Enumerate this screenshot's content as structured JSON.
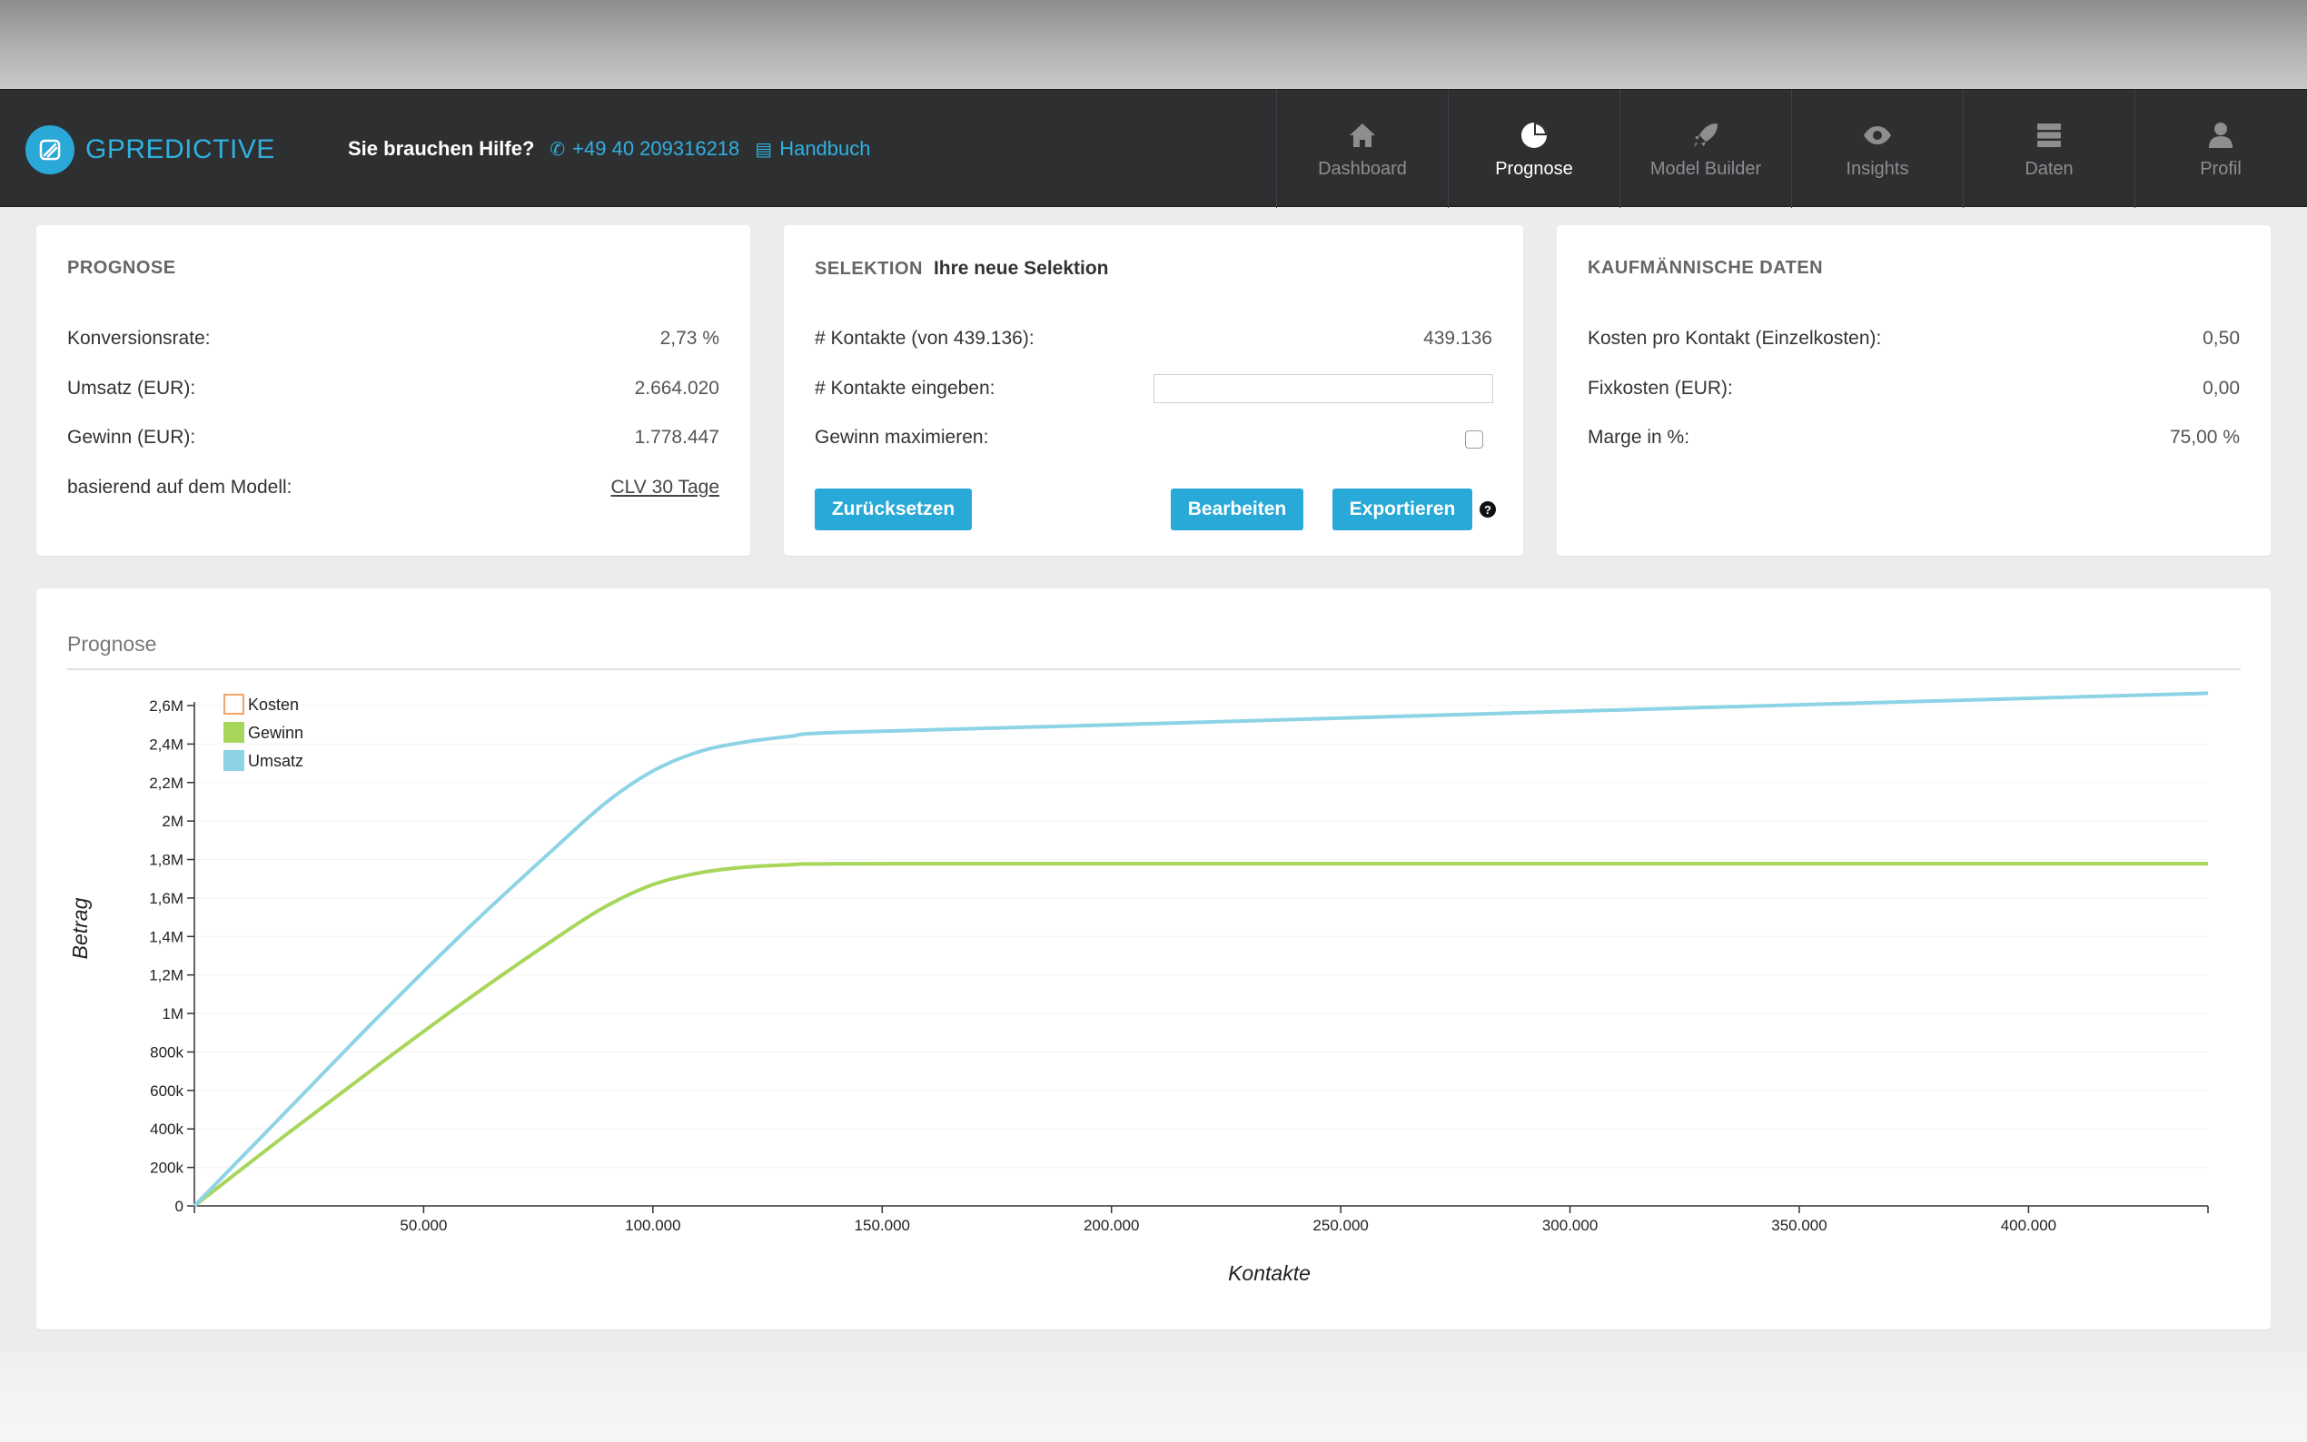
{
  "brand": {
    "name": "GPREDICTIVE"
  },
  "help": {
    "label": "Sie brauchen Hilfe?",
    "phone": "+49 40 209316218",
    "manual": "Handbuch"
  },
  "nav": {
    "items": [
      {
        "label": "Dashboard",
        "icon": "home-icon"
      },
      {
        "label": "Prognose",
        "icon": "pie-chart-icon",
        "active": true
      },
      {
        "label": "Model Builder",
        "icon": "rocket-icon"
      },
      {
        "label": "Insights",
        "icon": "eye-icon"
      },
      {
        "label": "Daten",
        "icon": "database-icon"
      },
      {
        "label": "Profil",
        "icon": "user-icon"
      }
    ]
  },
  "prognose": {
    "title": "PROGNOSE",
    "rows": [
      {
        "label": "Konversionsrate:",
        "value": "2,73 %"
      },
      {
        "label": "Umsatz (EUR):",
        "value": "2.664.020"
      },
      {
        "label": "Gewinn (EUR):",
        "value": "1.778.447"
      },
      {
        "label": "basierend auf dem Modell:",
        "value": "CLV 30 Tage"
      }
    ]
  },
  "selektion": {
    "title": "SELEKTION",
    "subtitle": "Ihre neue Selektion",
    "rows": [
      {
        "label": "# Kontakte (von 439.136):",
        "value": "439.136"
      },
      {
        "label": "# Kontakte eingeben:",
        "input_value": ""
      },
      {
        "label": "Gewinn maximieren:",
        "checked": false
      }
    ],
    "buttons": {
      "reset": "Zurücksetzen",
      "edit": "Bearbeiten",
      "export": "Exportieren"
    }
  },
  "kaufmaennisch": {
    "title": "KAUFMÄNNISCHE DATEN",
    "rows": [
      {
        "label": "Kosten pro Kontakt (Einzelkosten):",
        "value": "0,50"
      },
      {
        "label": "Fixkosten (EUR):",
        "value": "0,00"
      },
      {
        "label": "Marge in %:",
        "value": "75,00 %"
      }
    ]
  },
  "colors": {
    "accent": "#29a9d7",
    "navbar": "#2e2f31",
    "umsatz": "#8dd3e6",
    "gewinn": "#a7d65a",
    "kosten": "#f2a56b"
  },
  "chart_data": {
    "type": "line",
    "title": "Prognose",
    "xlabel": "Kontakte",
    "ylabel": "Betrag",
    "xlim": [
      0,
      439136
    ],
    "ylim": [
      0,
      2600000
    ],
    "x_ticks": [
      50000,
      100000,
      150000,
      200000,
      250000,
      300000,
      350000,
      400000
    ],
    "x_tick_labels": [
      "50.000",
      "100.000",
      "150.000",
      "200.000",
      "250.000",
      "300.000",
      "350.000",
      "400.000"
    ],
    "y_ticks": [
      0,
      200000,
      400000,
      600000,
      800000,
      1000000,
      1200000,
      1400000,
      1600000,
      1800000,
      2000000,
      2200000,
      2400000,
      2600000
    ],
    "y_tick_labels": [
      "0",
      "200k",
      "400k",
      "600k",
      "800k",
      "1M",
      "1,2M",
      "1,4M",
      "1,6M",
      "1,8M",
      "2M",
      "2,2M",
      "2,4M",
      "2,6M"
    ],
    "legend": [
      "Kosten",
      "Gewinn",
      "Umsatz"
    ],
    "legend_position": "top-left",
    "series": [
      {
        "name": "Kosten",
        "x": [],
        "y": []
      },
      {
        "name": "Gewinn",
        "x": [
          0,
          20000,
          40000,
          60000,
          80000,
          90000,
          100000,
          110000,
          120000,
          130000,
          140000,
          200000,
          300000,
          439136
        ],
        "y": [
          0,
          370000,
          730000,
          1080000,
          1410000,
          1560000,
          1670000,
          1730000,
          1760000,
          1773000,
          1778000,
          1778447,
          1778447,
          1778447
        ]
      },
      {
        "name": "Umsatz",
        "x": [
          0,
          20000,
          40000,
          60000,
          80000,
          90000,
          100000,
          110000,
          120000,
          130000,
          140000,
          200000,
          300000,
          439136
        ],
        "y": [
          0,
          490000,
          980000,
          1450000,
          1890000,
          2100000,
          2260000,
          2360000,
          2410000,
          2440000,
          2460000,
          2500000,
          2570000,
          2664020
        ]
      }
    ]
  }
}
